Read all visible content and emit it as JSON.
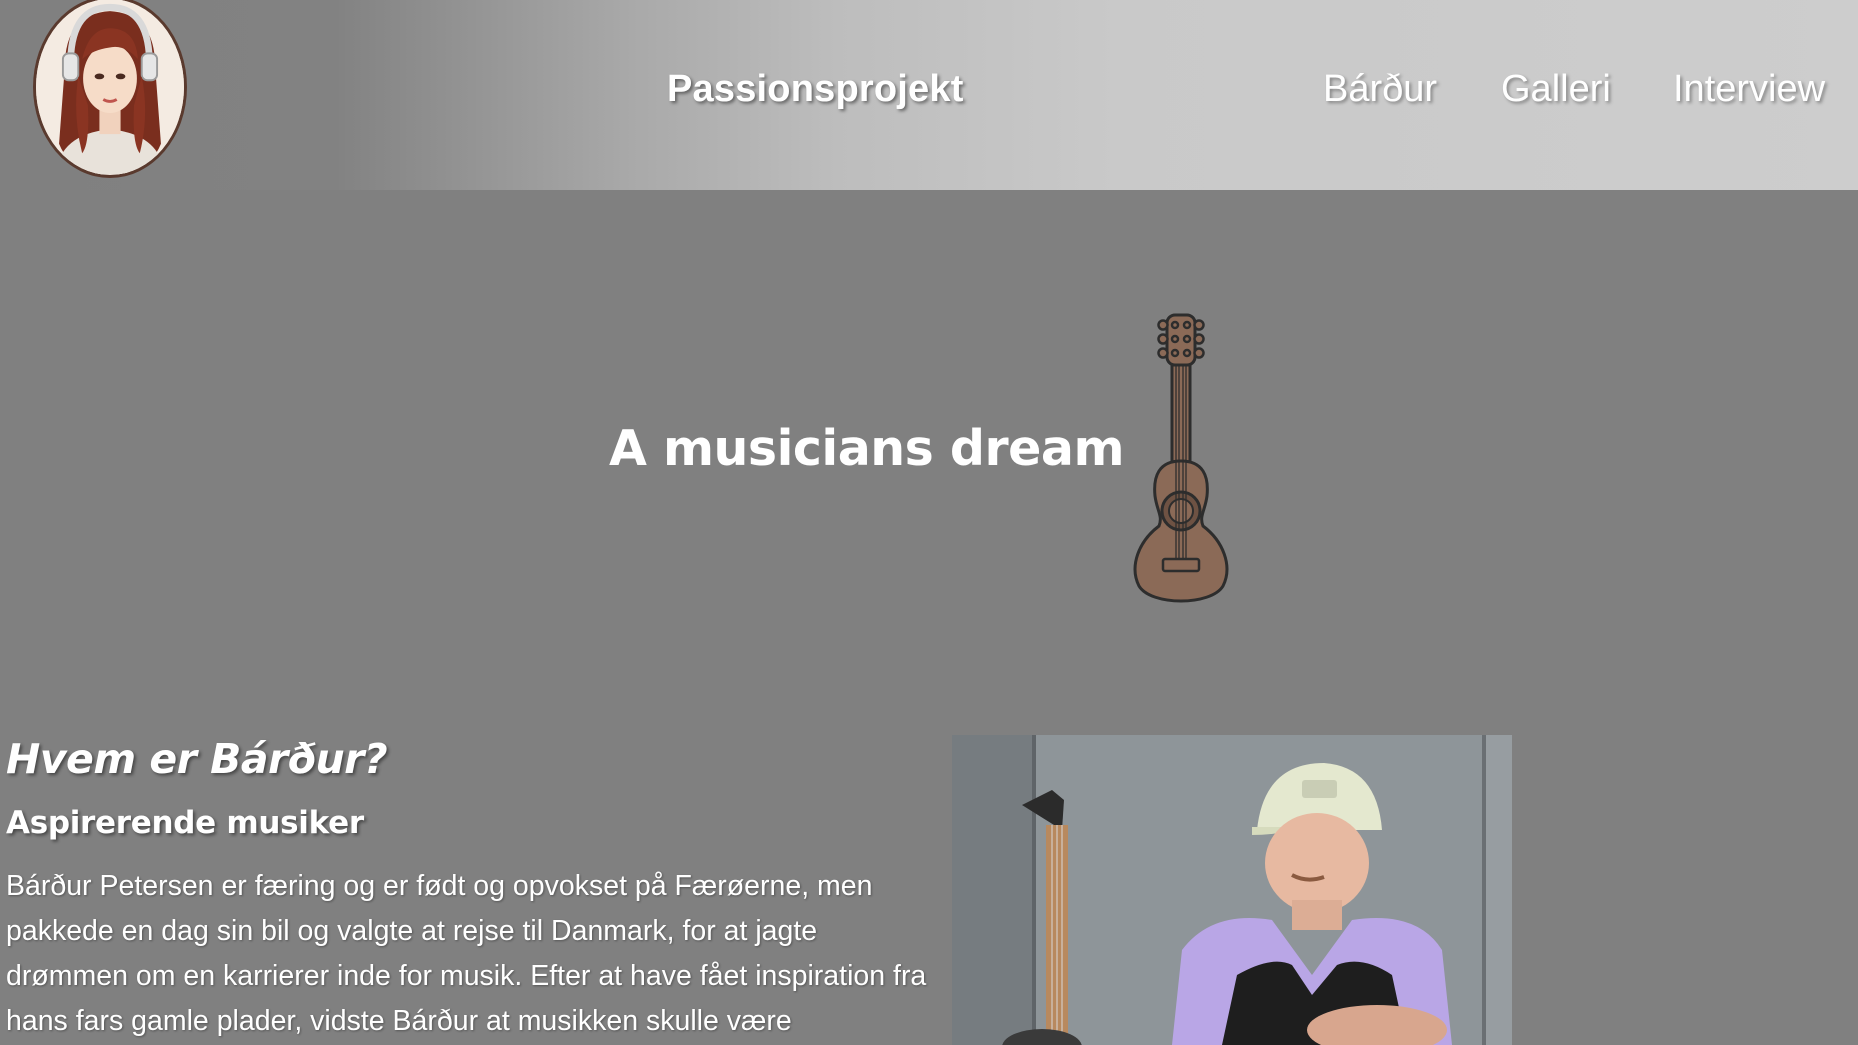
{
  "header": {
    "brand": "Passionsprojekt",
    "logo_icon": "avatar-girl-headphones-icon",
    "nav": [
      {
        "label": "Bárður"
      },
      {
        "label": "Galleri"
      },
      {
        "label": "Interview"
      }
    ]
  },
  "hero": {
    "title": "A musicians dream",
    "icon": "guitar-icon"
  },
  "about": {
    "heading": "Hvem er Bárður?",
    "subheading": "Aspirerende musiker",
    "body": "Bárður Petersen er færing og er født og opvokset på Færøerne, men pakkede en dag sin bil og valgte at rejse til Danmark, for at jagte drømmen om en karrierer inde for musik. Efter at have fået inspiration fra hans fars gamle plader, vidste Bárður at musikken skulle være"
  },
  "colors": {
    "page_background": "#808080",
    "header_gradient_end": "#cdcdcd",
    "text": "#ffffff",
    "guitar_body": "#8b6a57"
  }
}
